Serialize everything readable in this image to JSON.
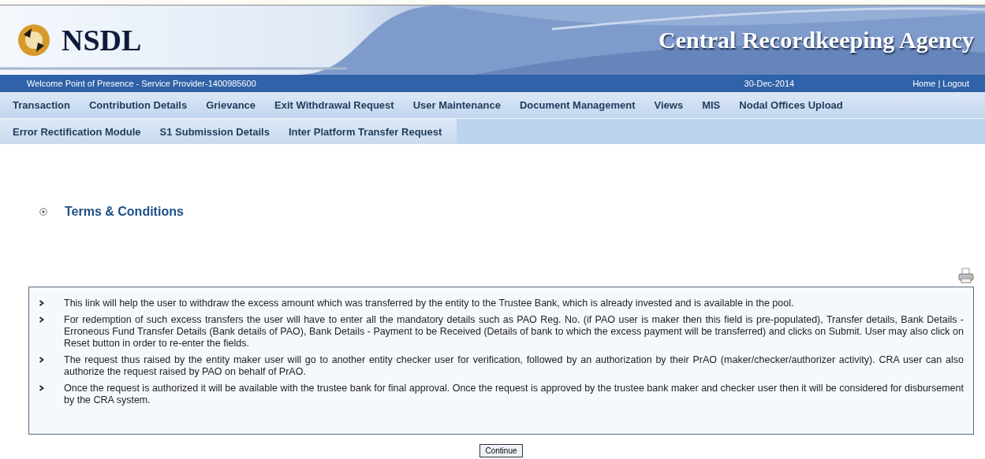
{
  "header": {
    "logo": "NSDL",
    "title": "Central Recordkeeping Agency"
  },
  "info_bar": {
    "welcome": "Welcome Point of Presence - Service Provider-1400985600",
    "date": "30-Dec-2014",
    "links": [
      "Home",
      "Logout"
    ],
    "separator": "|"
  },
  "menu_rows": [
    [
      "Transaction",
      "Contribution Details",
      "Grievance",
      "Exit Withdrawal Request",
      "User Maintenance",
      "Document Management",
      "Views",
      "MIS",
      "Nodal Offices Upload"
    ],
    [
      "Error Rectification Module",
      "S1 Submission Details",
      "Inter Platform Transfer Request"
    ]
  ],
  "section": {
    "title": "Terms & Conditions"
  },
  "terms": [
    "This link will help the user to withdraw the excess amount which was transferred by the entity to the Trustee Bank, which is already invested and is available in the pool.",
    "For redemption of such excess transfers the user will have to enter all the mandatory details such as PAO Reg. No. (if PAO user is maker then this field is pre-populated), Transfer details, Bank Details - Erroneous Fund Transfer Details (Bank details of PAO), Bank Details - Payment to be Received (Details of bank to which the excess payment will be transferred) and clicks on Submit. User may also click on Reset button in order to re-enter the fields.",
    "The request thus raised by the entity maker user will go to another entity checker user for verification, followed by an authorization by their PrAO (maker/checker/authorizer activity). CRA user can also authorize the request raised by PAO on behalf of PrAO.",
    "Once the request is authorized it will be available with the trustee bank for final approval. Once the request is approved by the trustee bank maker and checker user then it will be considered for disbursement by the CRA system."
  ],
  "buttons": [
    "Continue"
  ]
}
